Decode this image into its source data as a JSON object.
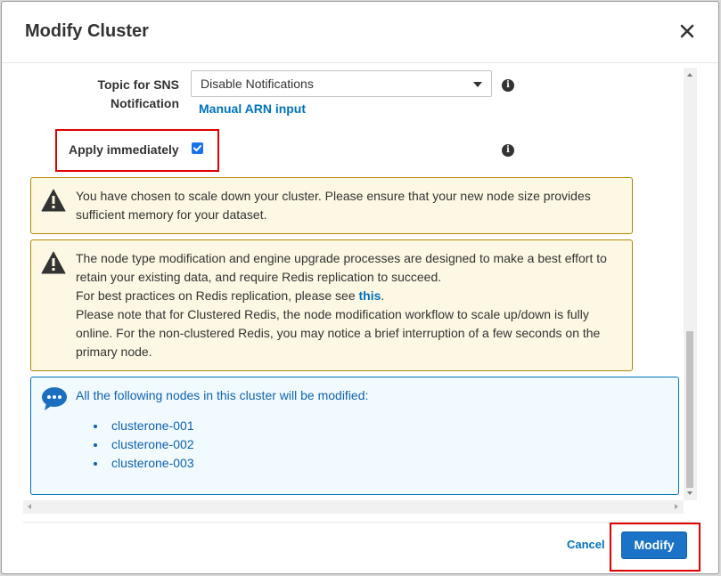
{
  "modal": {
    "title": "Modify Cluster"
  },
  "form": {
    "sns_label_line1": "Topic for SNS",
    "sns_label_line2": "Notification",
    "sns_select_value": "Disable Notifications",
    "manual_arn_link": "Manual ARN input",
    "apply_label": "Apply immediately",
    "apply_checked": true
  },
  "alerts": {
    "scale_down": {
      "text": "You have chosen to scale down your cluster. Please ensure that your new node size provides sufficient memory for your dataset."
    },
    "node_type": {
      "line1": "The node type modification and engine upgrade processes are designed to make a best effort to retain your existing data, and require Redis replication to succeed.",
      "line2_prefix": "For best practices on Redis replication, please see",
      "line2_link": "this",
      "line2_suffix": ".",
      "line3": "Please note that for Clustered Redis, the node modification workflow to scale up/down is fully online. For the non-clustered Redis, you may notice a brief interruption of a few seconds on the primary node."
    },
    "nodes": {
      "heading": "All the following nodes in this cluster will be modified:",
      "items": [
        "clusterone-001",
        "clusterone-002",
        "clusterone-003"
      ]
    }
  },
  "footer": {
    "cancel_label": "Cancel",
    "modify_label": "Modify"
  },
  "icons": {
    "close": "close-icon",
    "info": "info-icon",
    "warning": "warning-icon",
    "chat": "chat-bubble-icon"
  },
  "colors": {
    "link": "#0073bb",
    "primary_button": "#1a73c6",
    "warning_bg": "#fdf8e3",
    "info_bg": "#f1faff",
    "highlight": "#e00000"
  }
}
